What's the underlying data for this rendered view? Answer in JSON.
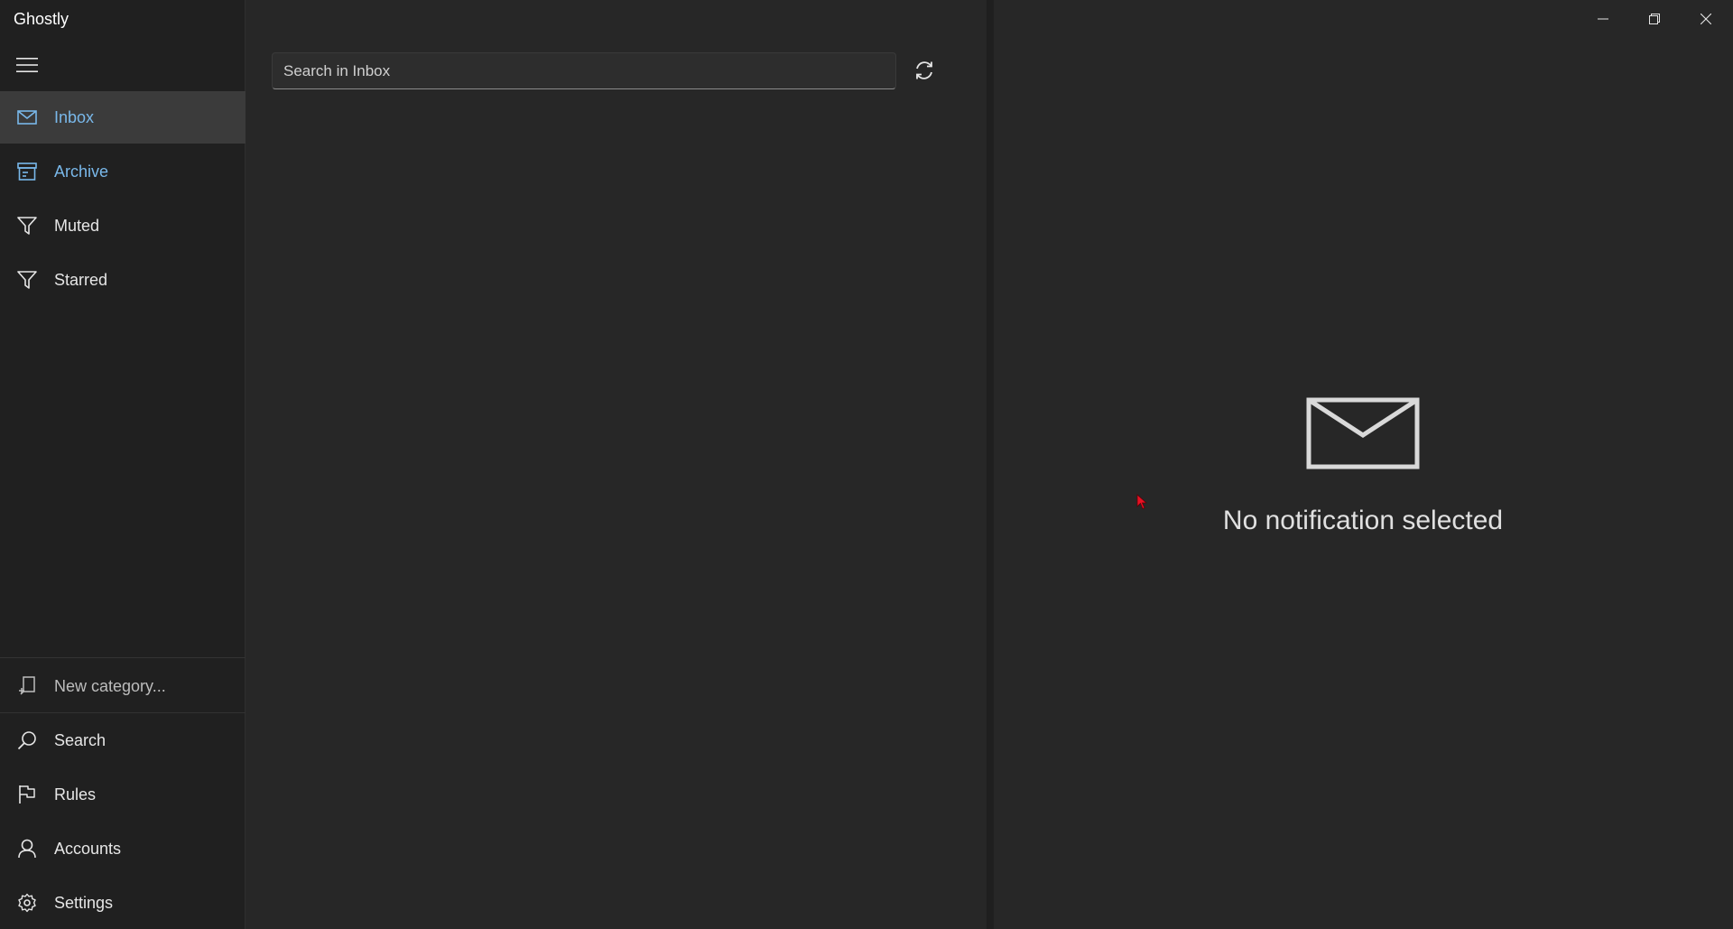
{
  "app": {
    "title": "Ghostly"
  },
  "window_controls": {
    "minimize_icon": "minimize-icon",
    "restore_icon": "restore-icon",
    "close_icon": "close-icon"
  },
  "sidebar": {
    "menu_icon": "hamburger-icon",
    "top_items": [
      {
        "label": "Inbox",
        "icon": "mail-icon",
        "selected": true
      },
      {
        "label": "Archive",
        "icon": "archive-icon",
        "selected": false
      },
      {
        "label": "Muted",
        "icon": "filter-icon",
        "selected": false
      },
      {
        "label": "Starred",
        "icon": "filter-icon",
        "selected": false
      }
    ],
    "new_category": {
      "label": "New category...",
      "icon": "add-category-icon"
    },
    "bottom_items": [
      {
        "label": "Search",
        "icon": "search-icon"
      },
      {
        "label": "Rules",
        "icon": "flag-icon"
      },
      {
        "label": "Accounts",
        "icon": "person-icon"
      },
      {
        "label": "Settings",
        "icon": "gear-icon"
      }
    ]
  },
  "list": {
    "search": {
      "placeholder": "Search in Inbox",
      "value": ""
    },
    "refresh_icon": "refresh-icon"
  },
  "detail": {
    "empty_icon": "envelope-icon",
    "empty_text": "No notification selected"
  },
  "colors": {
    "background": "#272727",
    "sidebar": "#202020",
    "selected_item": "#3b3b3b",
    "accent": "#79b8ea",
    "cursor": "#e81123"
  }
}
